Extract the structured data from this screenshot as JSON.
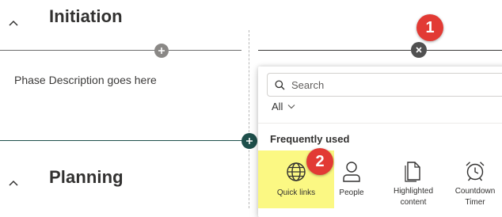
{
  "sections": [
    {
      "title": "Initiation"
    },
    {
      "title": "Planning"
    }
  ],
  "phase_description": "Phase Description goes here",
  "callouts": [
    "1",
    "2"
  ],
  "toolbox": {
    "search": {
      "placeholder": "Search",
      "value": ""
    },
    "filter_label": "All",
    "group_label": "Frequently used",
    "tiles": [
      {
        "label": "Quick links",
        "icon": "globe-icon",
        "highlighted": true
      },
      {
        "label": "People",
        "icon": "person-icon"
      },
      {
        "label": "Highlighted content",
        "icon": "document-icon"
      },
      {
        "label": "Countdown Timer",
        "icon": "alarm-clock-icon"
      }
    ]
  },
  "colors": {
    "teal": "#1e4f4b",
    "gray_button": "#6e6e6e",
    "dark_button": "#505050",
    "badge": "#e23a34",
    "highlight": "#fbf883"
  }
}
